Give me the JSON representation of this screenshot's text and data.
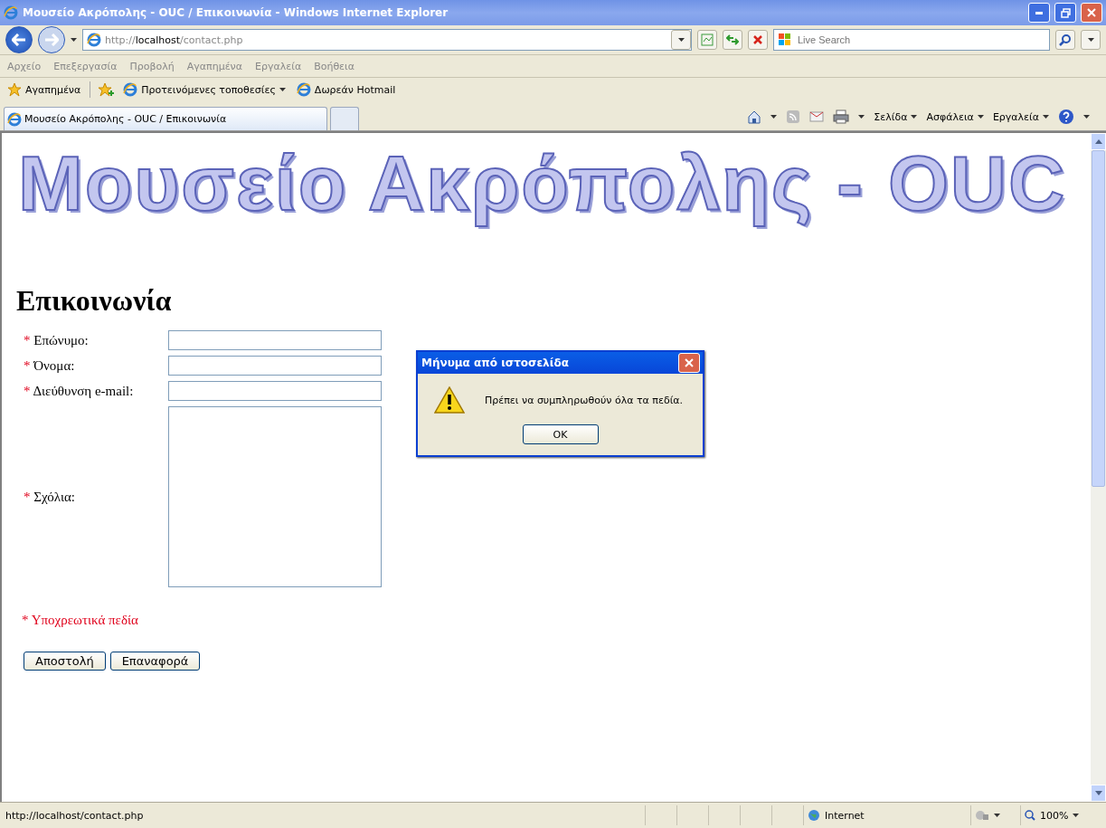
{
  "window": {
    "title": "Μουσείο Ακρόπολης - OUC / Επικοινωνία - Windows Internet Explorer"
  },
  "address_bar": {
    "url_prefix": "http://",
    "url_host": "localhost",
    "url_path": "/contact.php"
  },
  "search": {
    "placeholder": "Live Search"
  },
  "menu": [
    "Αρχείο",
    "Επεξεργασία",
    "Προβολή",
    "Αγαπημένα",
    "Εργαλεία",
    "Βοήθεια"
  ],
  "favorites_bar": {
    "favorites": "Αγαπημένα",
    "links": [
      {
        "label": "Προτεινόμενες τοποθεσίες",
        "dropdown": true
      },
      {
        "label": "Δωρεάν Hotmail",
        "dropdown": false
      }
    ]
  },
  "tabs": [
    {
      "label": "Μουσείο Ακρόπολης - OUC / Επικοινωνία",
      "selected": true
    },
    {
      "selected": false
    }
  ],
  "command_bar": [
    "Σελίδα",
    "Ασφάλεια",
    "Εργαλεία"
  ],
  "page": {
    "banner": "Μουσείο Ακρόπολης - OUC",
    "heading": "Επικοινωνία",
    "fields": [
      {
        "kind": "text",
        "label": "Επώνυμο:"
      },
      {
        "kind": "text",
        "label": "Όνομα:"
      },
      {
        "kind": "text",
        "label": "Διεύθυνση e-mail:"
      },
      {
        "kind": "textarea",
        "label": "Σχόλια:"
      }
    ],
    "required_mark": "*",
    "required_note": "Υποχρεωτικά πεδία",
    "buttons": [
      "Αποστολή",
      "Επαναφορά"
    ]
  },
  "dialog": {
    "title": "Μήνυμα από ιστοσελίδα",
    "message": "Πρέπει να συμπληρωθούν όλα τα πεδία.",
    "button": "OK"
  },
  "status_bar": {
    "url": "http://localhost/contact.php",
    "zone": "Internet",
    "zoom": "100%"
  }
}
